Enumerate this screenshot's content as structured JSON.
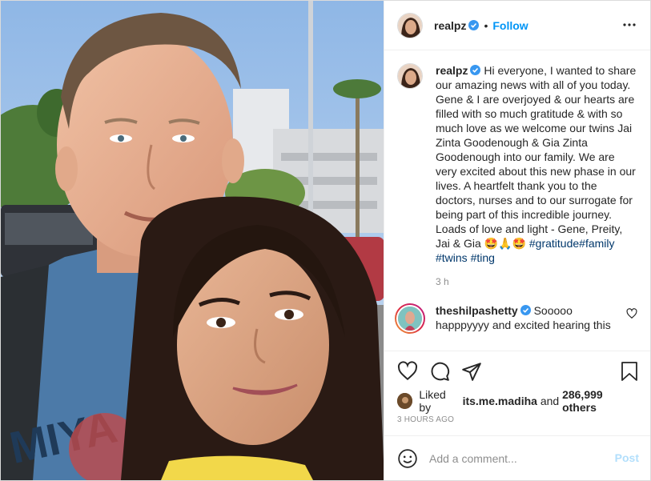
{
  "post": {
    "author": "realpz",
    "follow_label": "Follow",
    "separator": "•",
    "caption": {
      "username": "realpz",
      "text": "Hi everyone, I wanted to share our amazing news with all of you today. Gene & I are overjoyed & our hearts are filled with so much gratitude & with so much love as we welcome our twins Jai Zinta Goodenough & Gia Zinta Goodenough into our family. We are very excited about this new phase in our lives. A heartfelt thank you to the doctors, nurses and to our surrogate for being part of this incredible journey. Loads of love and light - Gene, Preity, Jai & Gia 🤩🙏🤩 ",
      "hashtags": [
        "#gratitude",
        "#family",
        "#twins",
        "#ting"
      ],
      "time": "3 h"
    },
    "comment": {
      "username": "theshilpashetty",
      "text": "Sooooo happpyyyy and excited hearing this"
    },
    "likes": {
      "prefix": "Liked by",
      "user": "its.me.madiha",
      "middle": "and",
      "count": "286,999 others"
    },
    "timestamp": "3 HOURS AGO",
    "add_comment_placeholder": "Add a comment...",
    "post_button": "Post"
  },
  "colors": {
    "accent": "#0095f6",
    "verified": "#3897f0",
    "hashtag": "#00376b",
    "muted": "#8e8e8e",
    "post_disabled": "#b2dffc"
  },
  "icons": [
    "more-options-icon",
    "verified-badge-icon",
    "heart-icon",
    "comment-icon",
    "share-icon",
    "bookmark-icon",
    "emoji-icon",
    "small-heart-icon"
  ]
}
